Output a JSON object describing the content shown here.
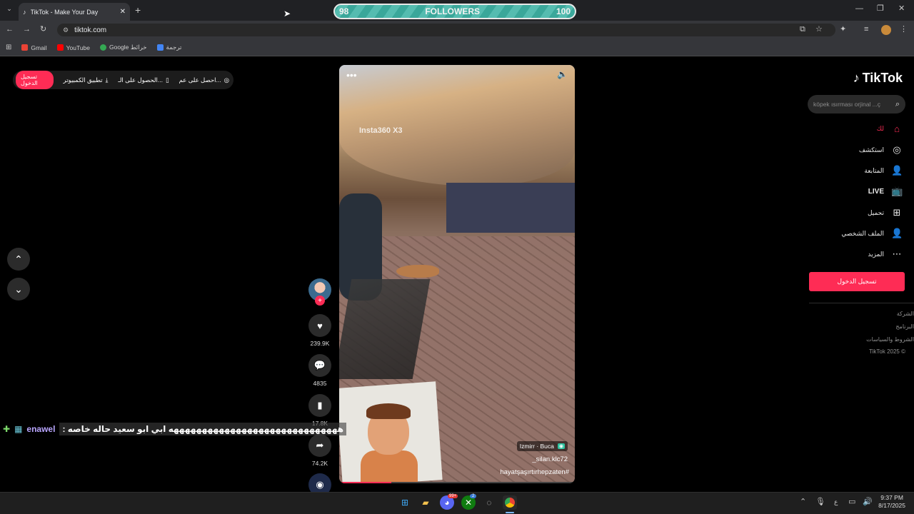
{
  "browser": {
    "tab_title": "TikTok - Make Your Day",
    "url": "tiktok.com",
    "bookmarks": [
      {
        "label": "Gmail",
        "color": "#ea4335"
      },
      {
        "label": "YouTube",
        "color": "#ff0000"
      },
      {
        "label": "Google خرائط",
        "color": "#34a853"
      },
      {
        "label": "ترجمة",
        "color": "#4285f4"
      }
    ]
  },
  "overlay": {
    "followers_current": "98",
    "followers_label": "FOLLOWERS",
    "followers_goal": "100",
    "progress": 0.98
  },
  "topbar": {
    "login": "تسجيل الدخول",
    "desktop_app": "تطبيق الكمبيوتر",
    "get_app": "الحصول على الـ...",
    "get_coins": "احصل على عم..."
  },
  "video": {
    "watermark": "Insta360 X3",
    "location": "Izmirr · Buca",
    "author": "_silan.klc72",
    "caption": "hayatşaşırtırhepzaten#",
    "progress": 0.22
  },
  "actions": {
    "likes": "239.9K",
    "comments": "4835",
    "saves": "17.8K",
    "shares": "74.2K"
  },
  "chat": {
    "username": "enawel",
    "message": ": ههههههههههههههههههههههههههههههه ابي ابو سعيد حاله خاصه"
  },
  "sidebar": {
    "brand": "TikTok",
    "search_placeholder": "köpek ısırması orjinal ...ç",
    "nav": [
      {
        "label": "لك",
        "icon": "home-icon",
        "active": true
      },
      {
        "label": "استكشف",
        "icon": "compass-icon"
      },
      {
        "label": "المتابعة",
        "icon": "user-follow-icon"
      },
      {
        "label": "LIVE",
        "icon": "live-tv-icon"
      },
      {
        "label": "تحميل",
        "icon": "upload-plus-icon"
      },
      {
        "label": "الملف الشخصي",
        "icon": "profile-icon"
      },
      {
        "label": "المزيد",
        "icon": "more-icon"
      }
    ],
    "login_button": "تسجيل الدخول",
    "footer": [
      "الشركة",
      "البرنامج",
      "الشروط والسياسات",
      "TikTok 2025 ©"
    ]
  },
  "taskbar": {
    "time": "9:37 PM",
    "date": "8/17/2025",
    "lang": "ع",
    "discord_badge": "99+",
    "xbox_badge": "2"
  },
  "colors": {
    "accent": "#fe2c55",
    "followers_teal": "#3aa79a"
  }
}
